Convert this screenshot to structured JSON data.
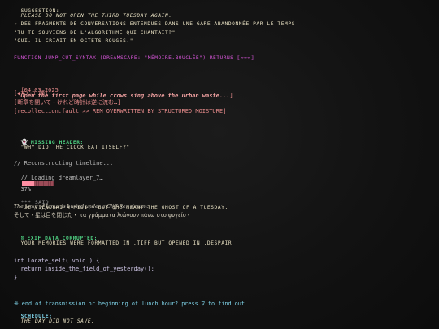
{
  "suggestion": {
    "label": "SUGGESTION:",
    "text": "PLEASE DO NOT OPEN THE THIRD TUESDAY AGAIN."
  },
  "fragments": {
    "line1": "→ DES FRAGMENTS DE CONVERSATIONS ENTENDUES DANS UNE GARE ABANDONNÉE PAR LE TEMPS",
    "line2": "\"TU TE SOUVIENS DE L'ALGORITHME QUI CHANTAIT?\"",
    "line3": "\"OUI. IL CRIAIT EN OCTETS ROUGES.\""
  },
  "function_line": "FUNCTION JUMP_CUT_SYNTAX (DREAMSCAPE: \"MÉMOIRE.BOUCLÉE\") RETURNS ⟦∞∞∞⟧",
  "log": {
    "timestamp": "[04.03.2025",
    "text": "Open the first page while crows sing above the urban waste...",
    "closing": "]",
    "glitch_line": "[◆ｱﾃｷ☆ﾕ 瀬]",
    "jp_line": "[断章を開いて・けれど時計は逆に流む…]",
    "fault_line": "[recollection.fault >> REM OVERWRITTEN BY STRUCTURED MOISTURE]"
  },
  "missing_header": {
    "label": "MISSING HEADER:",
    "text": "\"WHY DID THE CLOCK EAT ITSELF?\"",
    "icon": "ghost-icon"
  },
  "reconstruct": {
    "comment": "// Reconstructing timeline...",
    "loading_label": "// Loading dreamlayer_7…",
    "progress": 37,
    "progress_text": "37%"
  },
  "quote": {
    "prefix": "*** said",
    "text": "\"JE VIENDRAI À MIDI,\" BUT SHE MEANT THE GHOST OF A TUESDAY.",
    "blackletter": "The lamp of Janus is buried under a Cliff-Ren dream.",
    "multilang": "そして・星は目を閉じた・ τα γράμματα λιώνουν πάνω στο ψυγείο・"
  },
  "exif": {
    "label": "EXIF DATA CORRUPTED:",
    "text": "YOUR MEMORIES WERE FORMATTED IN .TIFF BUT OPENED IN .DESPAIR",
    "icon": "warning-icon"
  },
  "code": {
    "line1": "int locate_self( void ) {",
    "line2": "  return inside_the_field_of_yesterday();",
    "line3": "}"
  },
  "footer": {
    "transmission": "※ end of transmission or beginning of lunch hour? press ∇ to find out.",
    "schedule_label": "SCHEDULE:",
    "schedule_text": "THE DAY DID NOT SAVE."
  },
  "colors": {
    "background": "#101010",
    "text": "#e9e2c9",
    "magenta": "#d655d8",
    "salmon": "#e58a8a",
    "green": "#4fd082",
    "progress": "#ff8fa3"
  }
}
